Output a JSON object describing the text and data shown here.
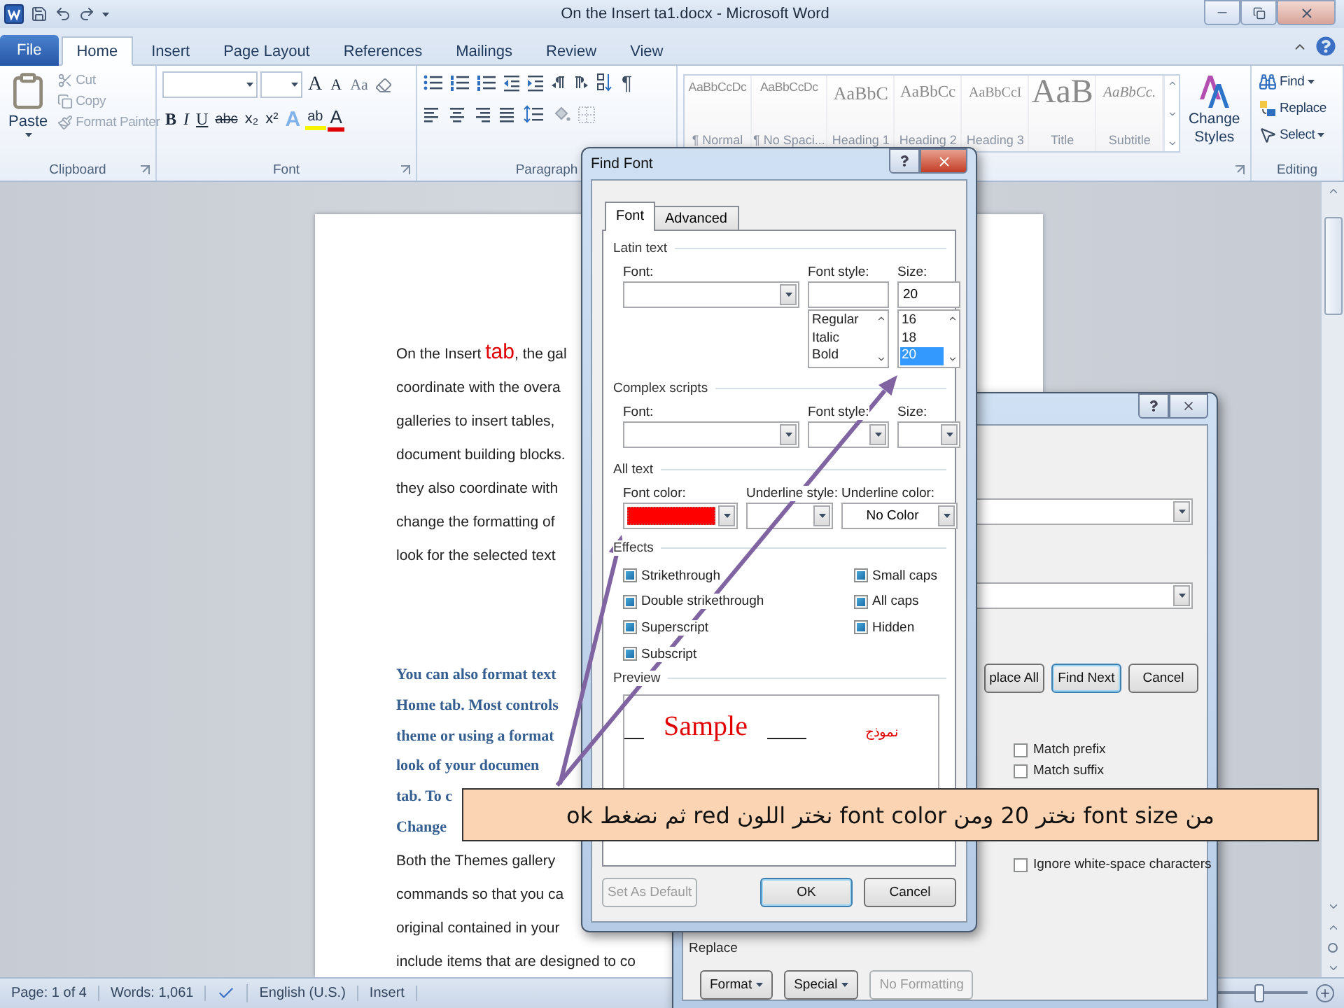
{
  "title_bar": {
    "title": "On the Insert ta1.docx - Microsoft Word"
  },
  "ribbon_tabs": [
    {
      "label": "File",
      "kind": "file",
      "selected": false
    },
    {
      "label": "Home",
      "kind": "tab",
      "selected": true
    },
    {
      "label": "Insert",
      "kind": "tab",
      "selected": false
    },
    {
      "label": "Page Layout",
      "kind": "tab",
      "selected": false
    },
    {
      "label": "References",
      "kind": "tab",
      "selected": false
    },
    {
      "label": "Mailings",
      "kind": "tab",
      "selected": false
    },
    {
      "label": "Review",
      "kind": "tab",
      "selected": false
    },
    {
      "label": "View",
      "kind": "tab",
      "selected": false
    }
  ],
  "clipboard": {
    "label": "Clipboard",
    "paste": "Paste",
    "actions": [
      {
        "label": "Cut",
        "kind": "cut",
        "disabled": true
      },
      {
        "label": "Copy",
        "kind": "copy",
        "disabled": true
      },
      {
        "label": "Format Painter",
        "kind": "painter",
        "disabled": true
      }
    ]
  },
  "font_group": {
    "label": "Font",
    "size_buttons": [
      {
        "label": "A",
        "kind": "grow"
      },
      {
        "label": "A",
        "kind": "shrink"
      },
      {
        "label": "Aa",
        "kind": "case"
      }
    ],
    "format_buttons": [
      {
        "label": "B",
        "kind": "bold"
      },
      {
        "label": "I",
        "kind": "italic"
      },
      {
        "label": "U",
        "kind": "underline"
      },
      {
        "label": "abc",
        "kind": "strike"
      },
      {
        "label": "x₂",
        "kind": "subscript"
      },
      {
        "label": "x²",
        "kind": "superscript"
      },
      {
        "label": "A",
        "kind": "effects"
      },
      {
        "label": "ab",
        "kind": "highlight"
      },
      {
        "label": "A",
        "kind": "color"
      }
    ]
  },
  "paragraph_group": {
    "label": "Paragraph",
    "show_marks": "¶"
  },
  "styles": [
    {
      "preview": "AaBbCcDc",
      "name": "¶ Normal",
      "kind": "normal"
    },
    {
      "preview": "AaBbCcDc",
      "name": "¶ No Spaci...",
      "kind": "normal"
    },
    {
      "preview": "AaBbC",
      "name": "Heading 1",
      "kind": "heading1"
    },
    {
      "preview": "AaBbCc",
      "name": "Heading 2",
      "kind": "heading2"
    },
    {
      "preview": "AaBbCcI",
      "name": "Heading 3",
      "kind": "heading3"
    },
    {
      "preview": "AaB",
      "name": "Title",
      "kind": "title"
    },
    {
      "preview": "AaBbCc.",
      "name": "Subtitle",
      "kind": "subtitle"
    }
  ],
  "change_styles": "Change Styles",
  "editing": {
    "label": "Editing",
    "actions": [
      {
        "label": "Find",
        "kind": "find",
        "menu": true
      },
      {
        "label": "Replace",
        "kind": "replace",
        "menu": false
      },
      {
        "label": "Select",
        "kind": "select",
        "menu": true
      }
    ]
  },
  "document": {
    "paragraphs": [
      {
        "kind": "body",
        "lines": [
          [
            {
              "text": "On the Insert "
            },
            {
              "text": "tab",
              "emphasis": true
            },
            {
              "text": ", the gal"
            }
          ],
          [
            {
              "text": "coordinate with the overa"
            }
          ],
          [
            {
              "text": "galleries to insert tables,"
            }
          ],
          [
            {
              "text": "document building blocks."
            }
          ],
          [
            {
              "text": "they also coordinate with"
            }
          ],
          [
            {
              "text": "change the formatting of"
            }
          ],
          [
            {
              "text": "look for the selected text"
            }
          ]
        ]
      },
      {
        "kind": "highlighted",
        "lines": [
          [
            {
              "text": "You can also format text"
            }
          ],
          [
            {
              "text": "Home tab. Most controls"
            }
          ],
          [
            {
              "text": "theme or using a format"
            }
          ],
          [
            {
              "text": "look of your documen"
            }
          ],
          [
            {
              "text": "tab. To c"
            }
          ],
          [
            {
              "text": "Change"
            }
          ]
        ]
      },
      {
        "kind": "body",
        "lines": [
          [
            {
              "text": "Both the Themes gallery"
            }
          ],
          [
            {
              "text": "commands so that you ca"
            }
          ],
          [
            {
              "text": "original contained in your"
            }
          ],
          [
            {
              "text": "include items that are designed to co"
            }
          ]
        ]
      }
    ]
  },
  "status_bar": {
    "page": "Page: 1 of 4",
    "words": "Words: 1,061",
    "language": "English (U.S.)",
    "mode": "Insert",
    "zoom": {
      "level": 0.45
    }
  },
  "find_font": {
    "title": "Find Font",
    "tabs": [
      {
        "label": "Font",
        "selected": true
      },
      {
        "label": "Advanced",
        "selected": false
      }
    ],
    "latin": {
      "heading": "Latin text",
      "font_label": "Font:",
      "style_label": "Font style:",
      "size_label": "Size:",
      "size_value": "20",
      "styles": [
        {
          "label": "Regular",
          "selected": false
        },
        {
          "label": "Italic",
          "selected": false
        },
        {
          "label": "Bold",
          "selected": false
        }
      ],
      "sizes": [
        {
          "label": "16",
          "selected": false
        },
        {
          "label": "18",
          "selected": false
        },
        {
          "label": "20",
          "selected": true
        }
      ]
    },
    "complex": {
      "heading": "Complex scripts",
      "font_label": "Font:",
      "style_label": "Font style:",
      "size_label": "Size:"
    },
    "all_text": {
      "heading": "All text",
      "color_label": "Font color:",
      "color": "#ff0000",
      "underline_label": "Underline style:",
      "underline_color_label": "Underline color:",
      "underline_color_value": "No Color"
    },
    "effects": {
      "heading": "Effects",
      "items": [
        {
          "label": "Strikethrough",
          "indeterminate": true
        },
        {
          "label": "Double strikethrough",
          "indeterminate": true
        },
        {
          "label": "Superscript",
          "indeterminate": true
        },
        {
          "label": "Subscript",
          "indeterminate": true
        },
        {
          "label": "Small caps",
          "indeterminate": true
        },
        {
          "label": "All caps",
          "indeterminate": true
        },
        {
          "label": "Hidden",
          "indeterminate": true
        }
      ]
    },
    "preview": {
      "heading": "Preview",
      "latin": "Sample",
      "complex": "نموذج"
    },
    "buttons": [
      {
        "label": "Set As Default",
        "kind": "left",
        "disabled": true,
        "default": false
      },
      {
        "label": "OK",
        "kind": "right",
        "disabled": false,
        "default": true
      },
      {
        "label": "Cancel",
        "kind": "right",
        "disabled": false,
        "default": false
      }
    ]
  },
  "replace_dialog": {
    "buttons": [
      {
        "label": "place All",
        "default": false
      },
      {
        "label": "Find Next",
        "default": true
      },
      {
        "label": "Cancel",
        "default": false
      }
    ],
    "options": [
      {
        "label": "Match prefix",
        "checked": false
      },
      {
        "label": "Match suffix",
        "checked": false
      },
      {
        "label": "Ignore white-space characters",
        "checked": false
      }
    ],
    "replace_heading": "Replace",
    "bottom_buttons": [
      {
        "label": "Format",
        "menu": true,
        "disabled": false
      },
      {
        "label": "Special",
        "menu": true,
        "disabled": false
      },
      {
        "label": "No Formatting",
        "menu": false,
        "disabled": true
      }
    ]
  },
  "callout": {
    "text": "من font size نختر 20 ومن font color نختر اللون red ثم نضغط ok"
  }
}
